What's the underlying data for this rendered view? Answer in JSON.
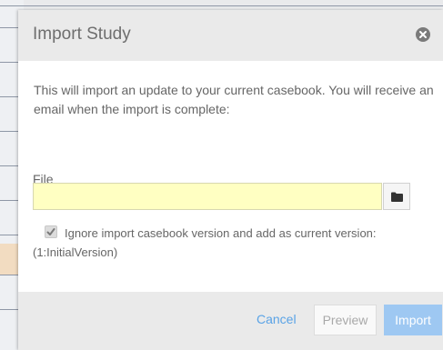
{
  "dialog": {
    "title": "Import Study",
    "message": "This will import an update to your current casebook. You will receive an email when the import is complete:",
    "file": {
      "label": "File",
      "value": "",
      "placeholder": ""
    },
    "checkbox": {
      "checked": true,
      "label": "Ignore import casebook version and add as current version: (1:InitialVersion)"
    },
    "buttons": {
      "cancel": "Cancel",
      "preview": "Preview",
      "import": "Import"
    },
    "icons": {
      "close": "close-icon",
      "browse": "folder-icon",
      "check": "checkmark-icon"
    }
  },
  "colors": {
    "accent": "#5aa3e6",
    "import_button": "#9ec8f2",
    "file_input_bg": "#ffffc2",
    "header_bg": "#eaeaea"
  }
}
